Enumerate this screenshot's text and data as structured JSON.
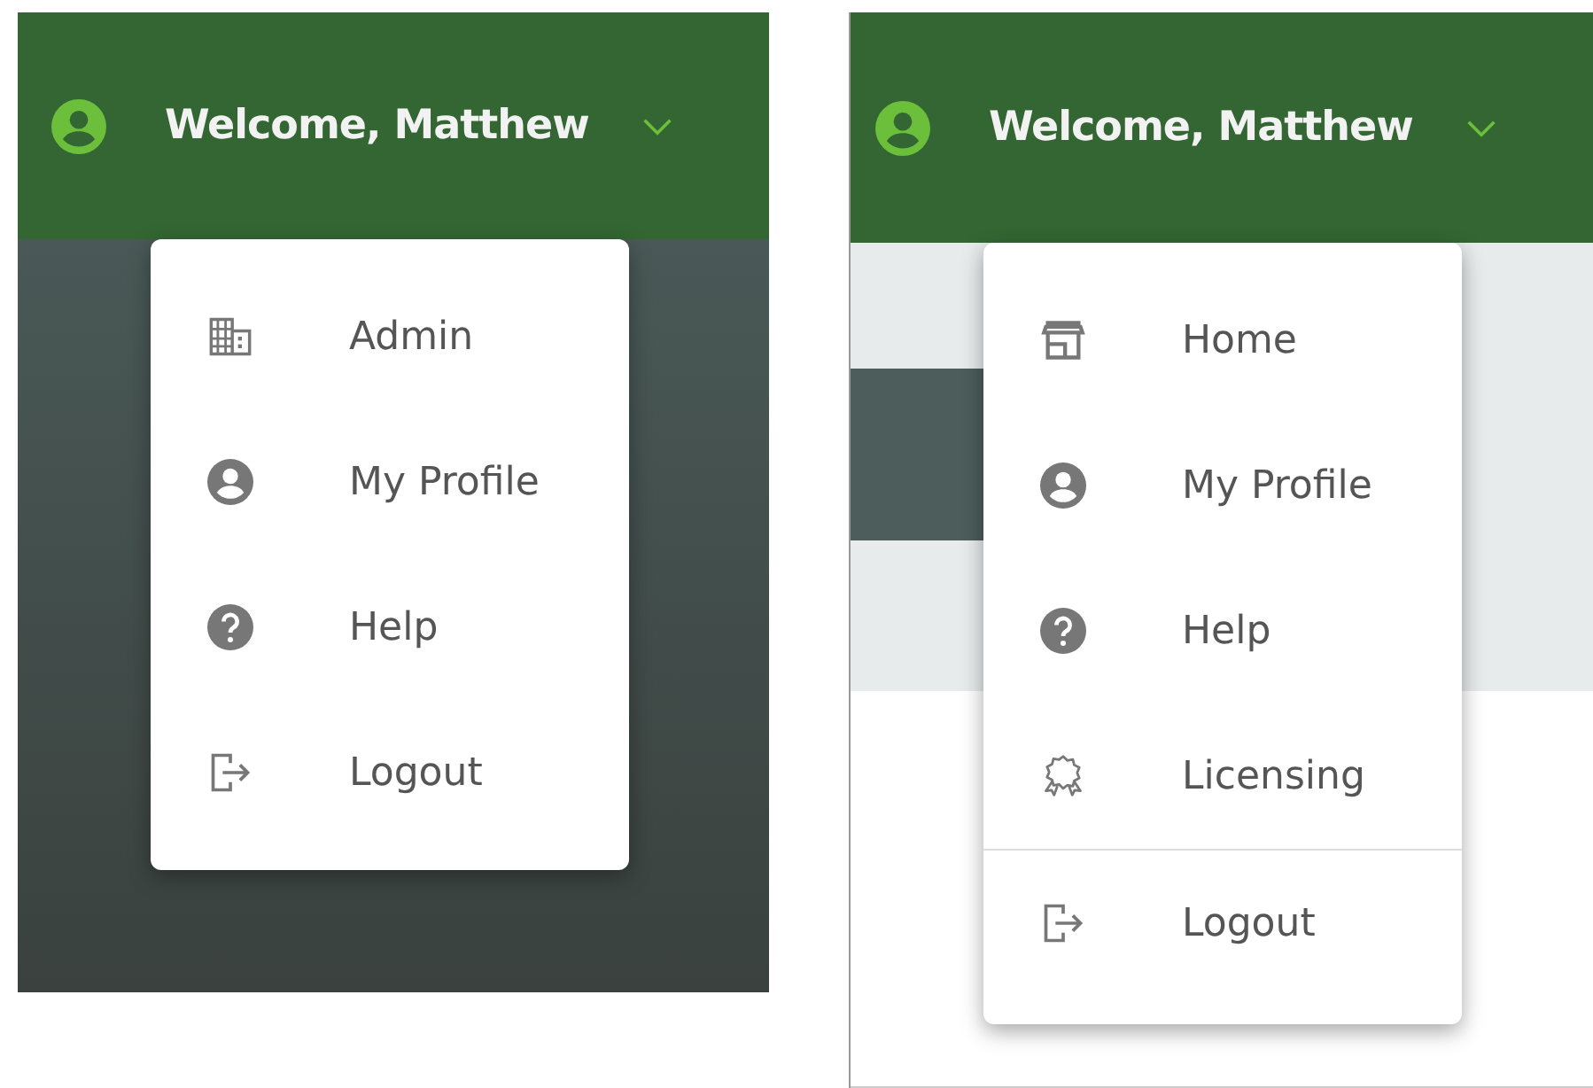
{
  "panels": [
    {
      "dark": true,
      "header": {
        "greeting": "Welcome, Matthew"
      },
      "menu": [
        {
          "kind": "building",
          "label": "Admin",
          "separated": false
        },
        {
          "kind": "profile",
          "label": "My Profile",
          "separated": false
        },
        {
          "kind": "help",
          "label": "Help",
          "separated": false
        },
        {
          "kind": "logout",
          "label": "Logout",
          "separated": false
        }
      ]
    },
    {
      "dark": false,
      "header": {
        "greeting": "Welcome, Matthew"
      },
      "menu": [
        {
          "kind": "store",
          "label": "Home",
          "separated": false
        },
        {
          "kind": "profile",
          "label": "My Profile",
          "separated": false
        },
        {
          "kind": "help",
          "label": "Help",
          "separated": false
        },
        {
          "kind": "award",
          "label": "Licensing",
          "separated": false
        },
        {
          "kind": "logout",
          "label": "Logout",
          "separated": true
        }
      ]
    }
  ]
}
